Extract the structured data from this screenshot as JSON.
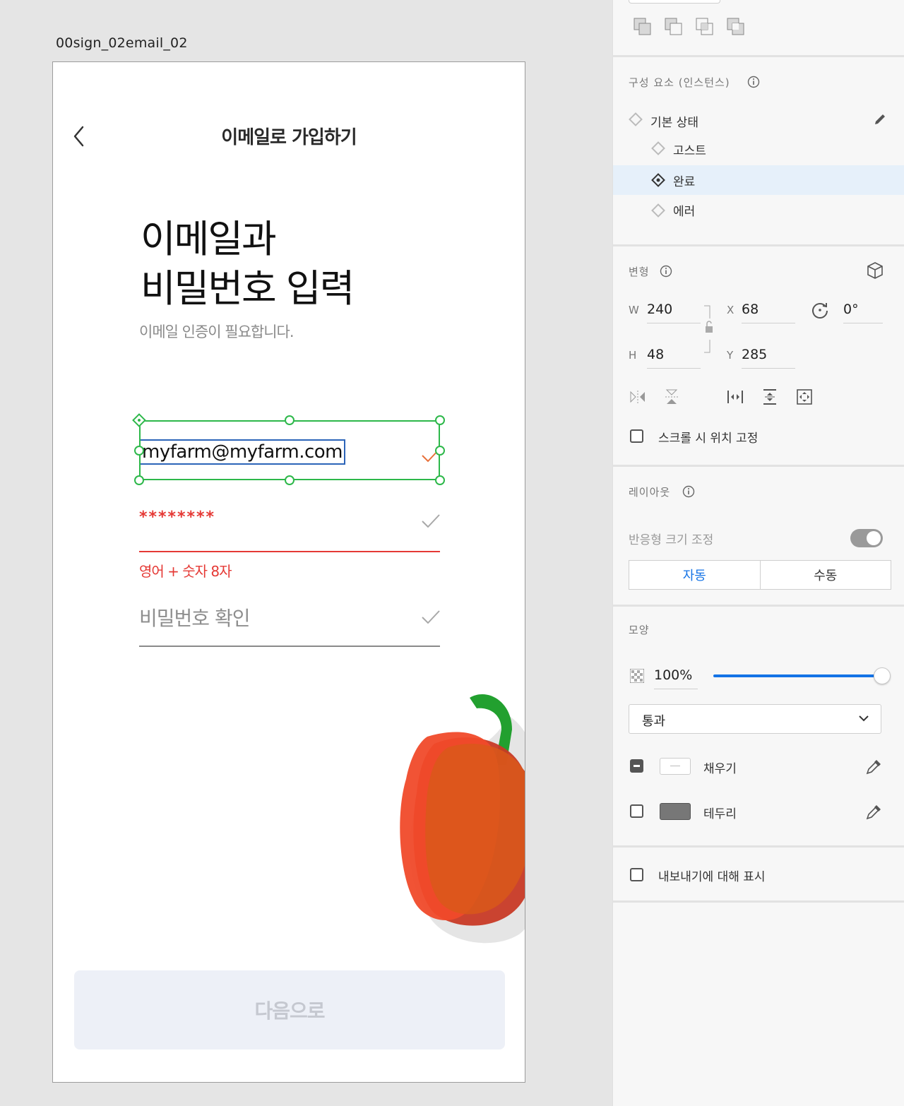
{
  "canvas": {
    "artboard_name": "00sign_02email_02",
    "screen": {
      "nav_title": "이메일로 가입하기",
      "headline_line1": "이메일과",
      "headline_line2": "비밀번호 입력",
      "subhead": "이메일 인증이 필요합니다.",
      "email_value": "myfarm@myfarm.com",
      "password_value": "********",
      "password_error": "영어 + 숫자 8자",
      "confirm_placeholder": "비밀번호 확인",
      "next_button": "다음으로"
    }
  },
  "panel": {
    "components": {
      "title": "구성 요소 (인스턴스)",
      "states": [
        {
          "label": "기본 상태",
          "active": false
        },
        {
          "label": "고스트",
          "active": false
        },
        {
          "label": "완료",
          "active": true
        },
        {
          "label": "에러",
          "active": false
        }
      ]
    },
    "transform": {
      "title": "변형",
      "w_label": "W",
      "w_value": "240",
      "h_label": "H",
      "h_value": "48",
      "x_label": "X",
      "x_value": "68",
      "y_label": "Y",
      "y_value": "285",
      "rotation": "0°",
      "fix_on_scroll": "스크롤 시 위치 고정"
    },
    "layout": {
      "title": "레이아웃",
      "responsive": "반응형 크기 조정",
      "auto": "자동",
      "manual": "수동"
    },
    "appearance": {
      "title": "모양",
      "opacity": "100%",
      "blend": "통과",
      "fill": "채우기",
      "border": "테두리"
    },
    "export": {
      "label": "내보내기에 대해 표시"
    }
  },
  "colors": {
    "accent": "#1473e6",
    "selection": "#2db84a",
    "error": "#e53935",
    "active_row": "#e6f0fa"
  }
}
